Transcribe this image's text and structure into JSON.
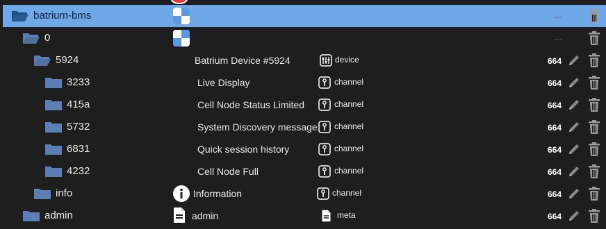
{
  "tree": [
    {
      "name": "batrium-bms",
      "desc": "",
      "type": "",
      "acl": "---",
      "icon": "checker-icon",
      "typeIcon": "",
      "folderIcon": "folder-open-icon",
      "selected": true,
      "editable": false
    },
    {
      "name": "0",
      "desc": "",
      "type": "",
      "acl": "---",
      "icon": "checker-icon",
      "typeIcon": "",
      "folderIcon": "folder-open-icon",
      "selected": false,
      "editable": false
    },
    {
      "name": "5924",
      "desc": "Batrium Device #5924",
      "type": "device",
      "acl": "664",
      "icon": "",
      "typeIcon": "device-icon",
      "folderIcon": "folder-open-icon",
      "selected": false,
      "editable": true
    },
    {
      "name": "3233",
      "desc": "Live Display",
      "type": "channel",
      "acl": "664",
      "icon": "",
      "typeIcon": "channel-icon",
      "folderIcon": "folder-icon",
      "selected": false,
      "editable": true
    },
    {
      "name": "415a",
      "desc": "Cell Node Status Limited",
      "type": "channel",
      "acl": "664",
      "icon": "",
      "typeIcon": "channel-icon",
      "folderIcon": "folder-icon",
      "selected": false,
      "editable": true
    },
    {
      "name": "5732",
      "desc": "System Discovery message",
      "type": "channel",
      "acl": "664",
      "icon": "",
      "typeIcon": "channel-icon",
      "folderIcon": "folder-icon",
      "selected": false,
      "editable": true
    },
    {
      "name": "6831",
      "desc": "Quick session history",
      "type": "channel",
      "acl": "664",
      "icon": "",
      "typeIcon": "channel-icon",
      "folderIcon": "folder-icon",
      "selected": false,
      "editable": true
    },
    {
      "name": "4232",
      "desc": "Cell Node Full",
      "type": "channel",
      "acl": "664",
      "icon": "",
      "typeIcon": "channel-icon",
      "folderIcon": "folder-icon",
      "selected": false,
      "editable": true
    },
    {
      "name": "info",
      "desc": "Information",
      "type": "channel",
      "acl": "664",
      "icon": "info-icon",
      "typeIcon": "channel-icon",
      "folderIcon": "folder-icon",
      "selected": false,
      "editable": true
    },
    {
      "name": "admin",
      "desc": "admin",
      "type": "meta",
      "acl": "664",
      "icon": "document-icon",
      "typeIcon": "document-icon",
      "folderIcon": "folder-icon",
      "selected": false,
      "editable": true
    }
  ],
  "colors": {
    "selected": "#6fa8e8",
    "folder": "#5b7fb4",
    "background": "#1e1e1e"
  }
}
